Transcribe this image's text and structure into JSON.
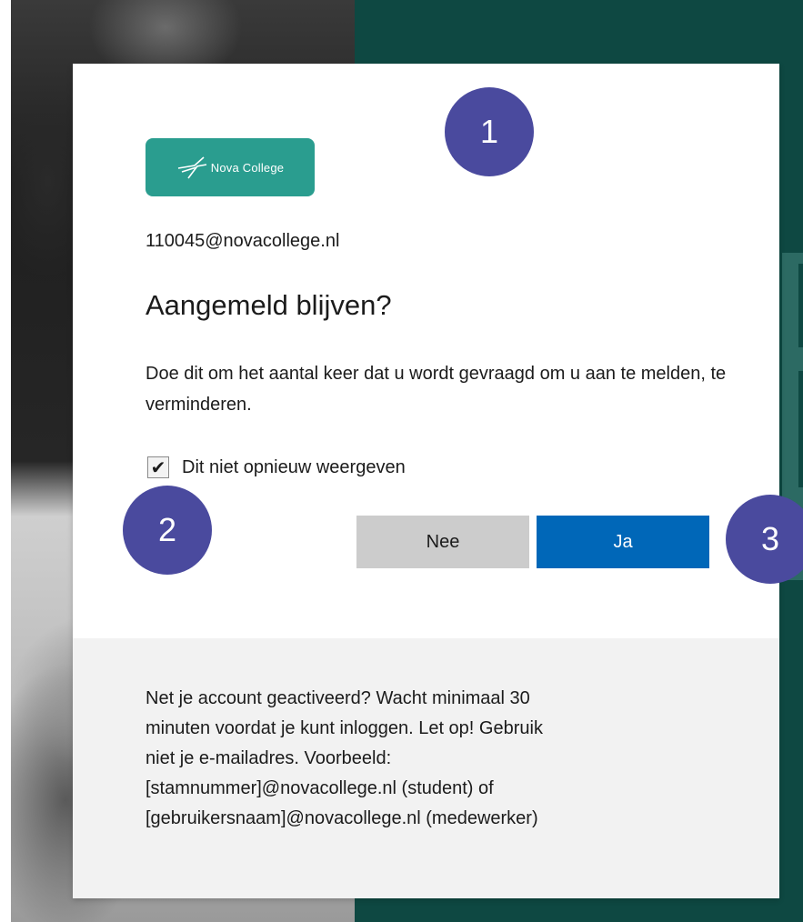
{
  "logo": {
    "brand_name": "Nova College",
    "color": "#2a9d8f"
  },
  "account": {
    "email": "110045@novacollege.nl"
  },
  "dialog": {
    "title": "Aangemeld blijven?",
    "description": "Doe dit om het aantal keer dat u wordt gevraagd om u aan te melden, te verminderen.",
    "checkbox_label": "Dit niet opnieuw weergeven",
    "checkbox_checked": true,
    "no_label": "Nee",
    "yes_label": "Ja",
    "primary_color": "#0067b8"
  },
  "footer": {
    "lines": [
      "Net je account geactiveerd? Wacht minimaal 30",
      "minuten voordat je kunt inloggen. Let op! Gebruik",
      "niet je e-mailadres. Voorbeeld:",
      "[stamnummer]@novacollege.nl (student) of",
      "[gebruikersnaam]@novacollege.nl (medewerker)"
    ]
  },
  "markers": [
    {
      "label": "1"
    },
    {
      "label": "2"
    },
    {
      "label": "3"
    }
  ],
  "icons": {
    "checkmark": "check-icon",
    "logo_mark": "nova-arrow-icon"
  }
}
